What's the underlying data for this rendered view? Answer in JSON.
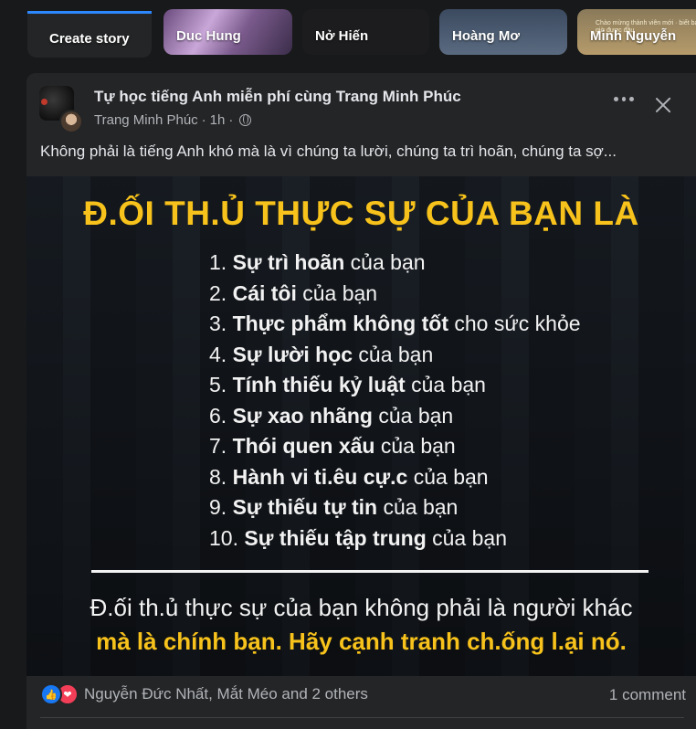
{
  "stories": [
    {
      "name": "Create story"
    },
    {
      "name": "Duc Hung"
    },
    {
      "name": "Nở Hiến"
    },
    {
      "name": "Hoàng Mơ"
    },
    {
      "name": "Minh Nguyễn",
      "caption": "Chào mừng thành viên mới · biết bao giờ được đâu"
    }
  ],
  "post": {
    "page_name": "Tự học tiếng Anh miễn phí cùng Trang Minh Phúc",
    "author": "Trang Minh Phúc",
    "time": "1h",
    "text": "Không phải là tiếng Anh khó mà là vì chúng ta lười, chúng ta trì hoãn, chúng ta sợ...",
    "image": {
      "title": "Đ.ỐI TH.Ủ THỰC SỰ CỦA BẠN LÀ",
      "items": [
        {
          "num": "1.",
          "bold": "Sự trì hoãn",
          "rest": " của bạn"
        },
        {
          "num": "2.",
          "bold": "Cái tôi",
          "rest": " của bạn"
        },
        {
          "num": "3.",
          "bold": "Thực phẩm không tốt",
          "rest": " cho sức khỏe"
        },
        {
          "num": "4.",
          "bold": "Sự lười học",
          "rest": " của bạn"
        },
        {
          "num": "5.",
          "bold": "Tính thiếu kỷ luật",
          "rest": " của bạn"
        },
        {
          "num": "6.",
          "bold": "Sự xao nhãng",
          "rest": " của bạn"
        },
        {
          "num": "7.",
          "bold": "Thói quen xấu",
          "rest": " của bạn"
        },
        {
          "num": "8.",
          "bold": "Hành vi ti.êu cự.c",
          "rest": " của bạn"
        },
        {
          "num": "9.",
          "bold": "Sự thiếu tự tin",
          "rest": " của bạn"
        },
        {
          "num": "10.",
          "bold": "Sự thiếu tập trung",
          "rest": " của bạn"
        }
      ],
      "conclusion_line1": "Đ.ối th.ủ thực sự của bạn không phải là người khác",
      "conclusion_line2": "mà là chính bạn. Hãy cạnh tranh ch.ống l.ại nó."
    },
    "reactions_text": "Nguyễn Đức Nhất, Mắt Méo and 2 others",
    "comments_text": "1 comment"
  },
  "colors": {
    "accent": "#f7c21b",
    "like": "#1877f2",
    "love": "#f33e58"
  }
}
